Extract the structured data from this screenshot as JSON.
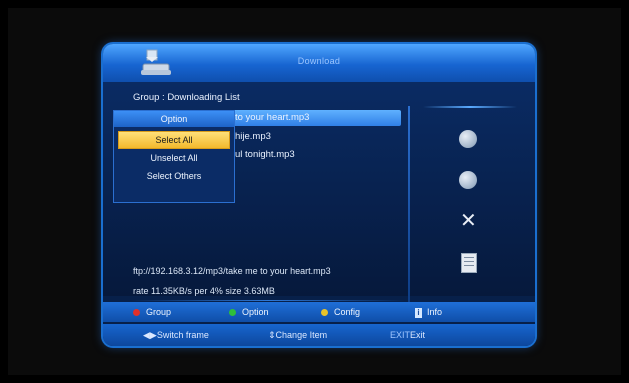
{
  "header": {
    "title": "Download"
  },
  "group_label": "Group : Downloading List",
  "list": [
    {
      "text": "to your heart.mp3",
      "selected": true
    },
    {
      "text": "hije.mp3",
      "selected": false
    },
    {
      "text": "ul tonight.mp3",
      "selected": false
    }
  ],
  "option_menu": {
    "title": "Option",
    "items": [
      {
        "label": "Select All",
        "active": true
      },
      {
        "label": "Unselect All",
        "active": false
      },
      {
        "label": "Select Others",
        "active": false
      }
    ]
  },
  "details": {
    "url": "ftp://192.168.3.12/mp3/take me to your heart.mp3",
    "rate": "rate 11.35KB/s  per 4%  size 3.63MB"
  },
  "right_icons": [
    "play-icon",
    "stop-icon",
    "delete-icon",
    "document-icon"
  ],
  "footer": {
    "keys": [
      {
        "label": "Group",
        "color": "#e0302a"
      },
      {
        "label": "Option",
        "color": "#2fbf3a"
      },
      {
        "label": "Config",
        "color": "#e8c32a"
      },
      {
        "label": "Info",
        "icon": "info-icon"
      }
    ],
    "hints": {
      "switch_frame": "Switch frame",
      "change_item": "Change Item",
      "exit_key": "EXIT",
      "exit_label": "Exit"
    }
  }
}
